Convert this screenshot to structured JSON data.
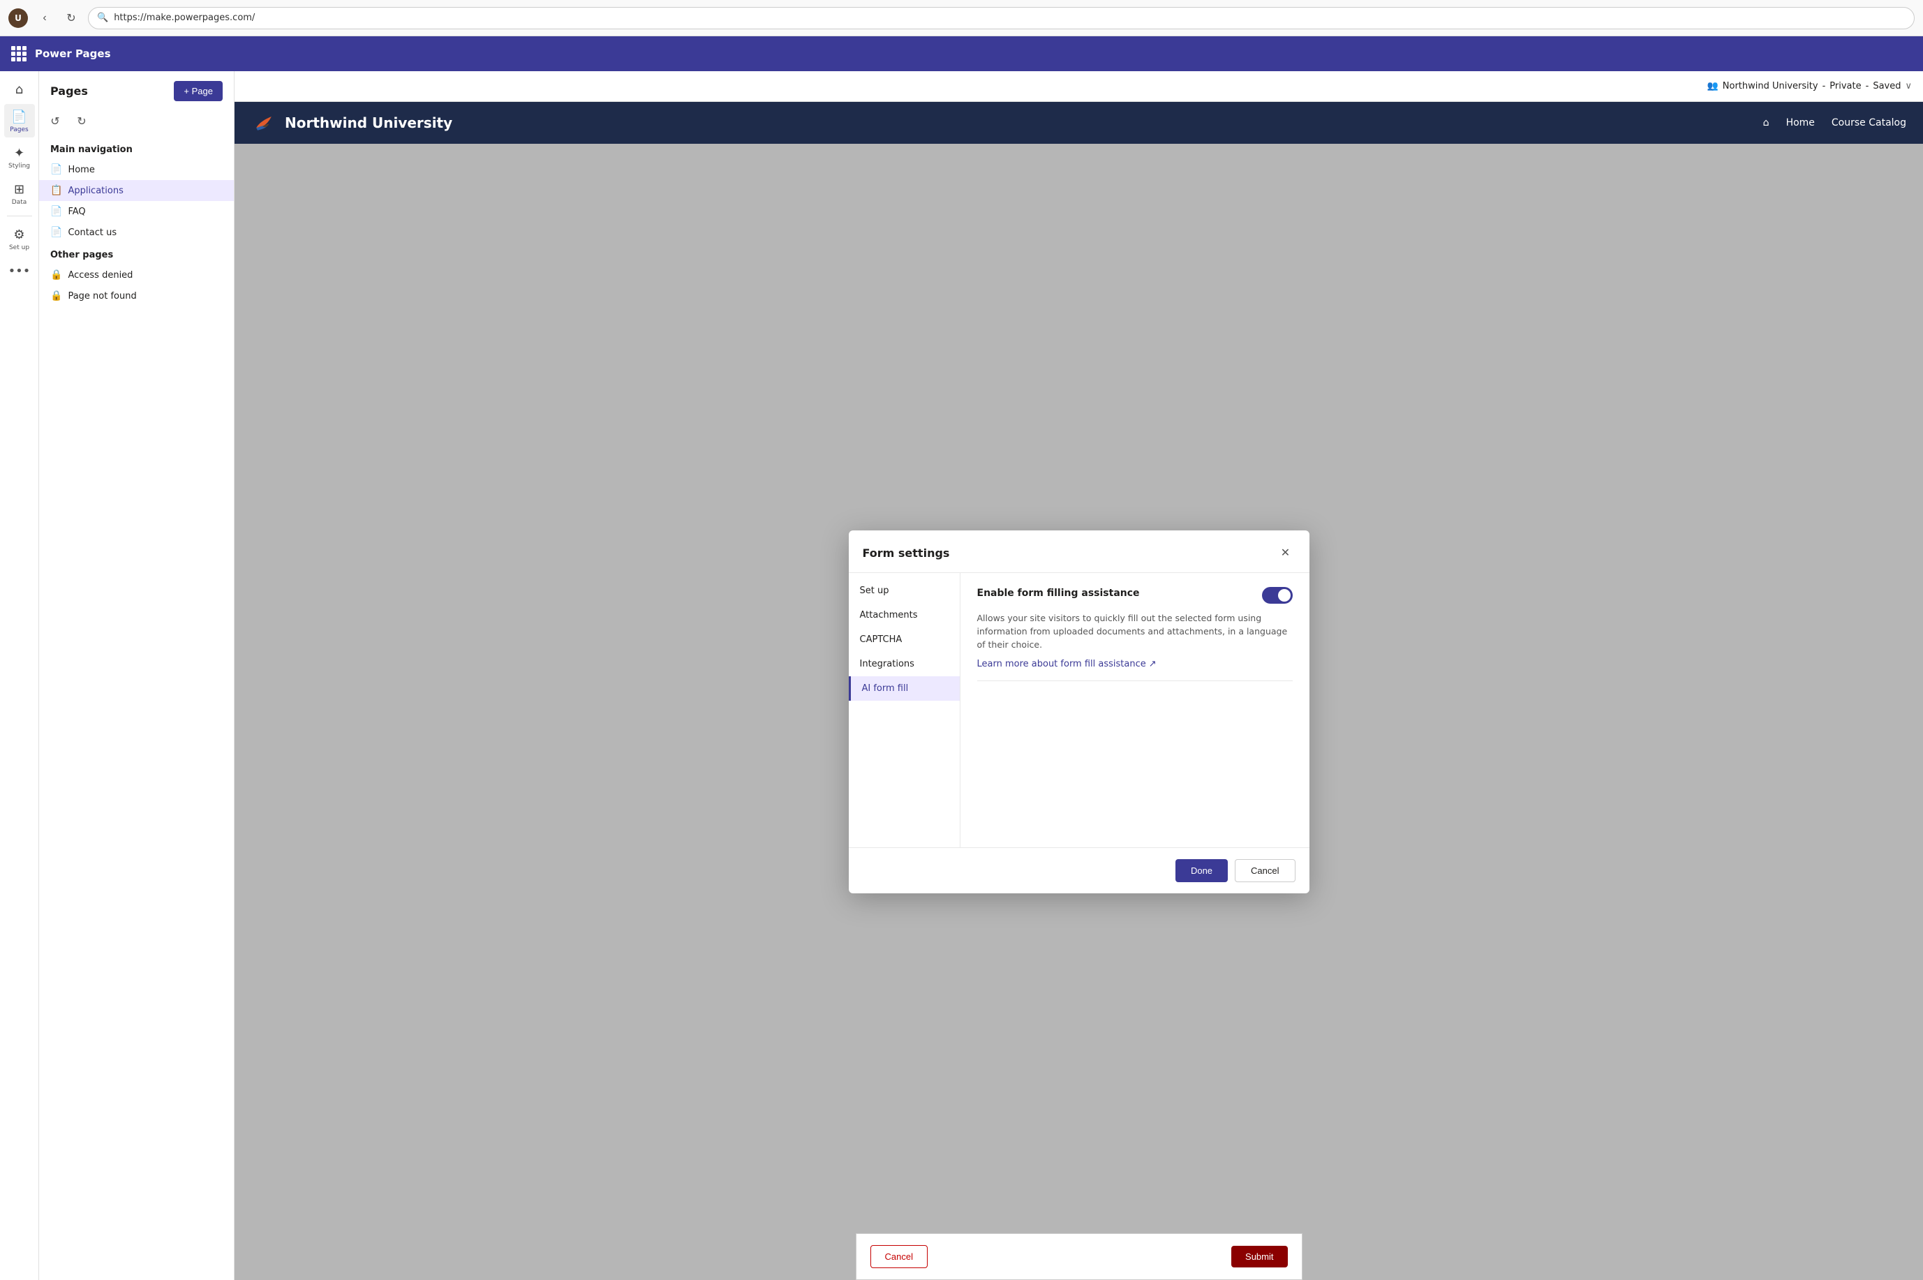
{
  "browser": {
    "url": "https://make.powerpages.com/",
    "search_icon": "🔍"
  },
  "app": {
    "title": "Power Pages",
    "grid_icon_label": "apps-icon"
  },
  "site_info": {
    "name": "Northwind University",
    "visibility": "Private",
    "status": "Saved",
    "chevron": "∨"
  },
  "toolbar": {
    "undo_label": "↺",
    "redo_label": "↻"
  },
  "left_sidebar": {
    "items": [
      {
        "id": "home",
        "icon": "⌂",
        "label": "Home"
      },
      {
        "id": "pages",
        "icon": "📄",
        "label": "Pages"
      },
      {
        "id": "styling",
        "icon": "🎨",
        "label": "Styling"
      },
      {
        "id": "data",
        "icon": "⊞",
        "label": "Data"
      },
      {
        "id": "setup",
        "icon": "⚙",
        "label": "Set up"
      }
    ],
    "more_label": "•••"
  },
  "pages_panel": {
    "title": "Pages",
    "add_button_label": "+ Page",
    "main_nav_title": "Main navigation",
    "main_nav_items": [
      {
        "id": "home",
        "label": "Home",
        "icon": "📄",
        "active": false
      },
      {
        "id": "applications",
        "label": "Applications",
        "icon": "📋",
        "active": true
      },
      {
        "id": "faq",
        "label": "FAQ",
        "icon": "📄",
        "active": false
      },
      {
        "id": "contact",
        "label": "Contact us",
        "icon": "📄",
        "active": false
      }
    ],
    "other_pages_title": "Other pages",
    "other_pages_items": [
      {
        "id": "access-denied",
        "label": "Access denied",
        "icon": "🔒"
      },
      {
        "id": "page-not-found",
        "label": "Page not found",
        "icon": "🔒"
      }
    ]
  },
  "website": {
    "title": "Northwind University",
    "nav_items": [
      "Home",
      "Course Catalog"
    ],
    "form_cancel_label": "Cancel",
    "form_submit_label": "Submit"
  },
  "modal": {
    "title": "Form settings",
    "close_icon": "✕",
    "nav_items": [
      {
        "id": "setup",
        "label": "Set up",
        "active": false
      },
      {
        "id": "attachments",
        "label": "Attachments",
        "active": false
      },
      {
        "id": "captcha",
        "label": "CAPTCHA",
        "active": false
      },
      {
        "id": "integrations",
        "label": "Integrations",
        "active": false
      },
      {
        "id": "ai-form-fill",
        "label": "AI form fill",
        "active": true
      }
    ],
    "section_title": "Enable form filling assistance",
    "section_desc": "Allows your site visitors to quickly fill out the selected form using information from uploaded documents and attachments, in a language of their choice.",
    "learn_more_label": "Learn more about form fill assistance",
    "learn_more_icon": "↗",
    "toggle_enabled": true,
    "done_label": "Done",
    "cancel_label": "Cancel"
  }
}
